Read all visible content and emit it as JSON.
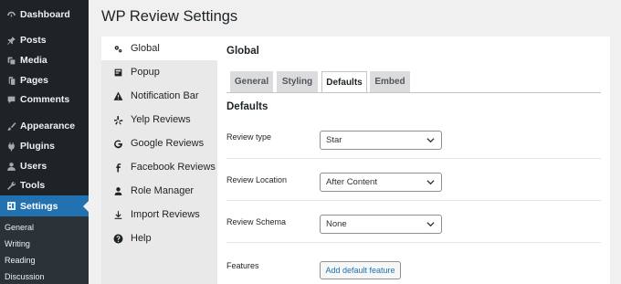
{
  "admin_menu": {
    "items": [
      {
        "label": "Dashboard",
        "icon": "dashboard-icon"
      },
      {
        "label": "Posts",
        "icon": "pin-icon"
      },
      {
        "label": "Media",
        "icon": "media-icon"
      },
      {
        "label": "Pages",
        "icon": "pages-icon"
      },
      {
        "label": "Comments",
        "icon": "comments-icon"
      },
      {
        "label": "Appearance",
        "icon": "brush-icon"
      },
      {
        "label": "Plugins",
        "icon": "plugin-icon"
      },
      {
        "label": "Users",
        "icon": "users-icon"
      },
      {
        "label": "Tools",
        "icon": "wrench-icon"
      },
      {
        "label": "Settings",
        "icon": "settings-icon"
      }
    ],
    "current": "Settings",
    "submenu": [
      "General",
      "Writing",
      "Reading",
      "Discussion"
    ]
  },
  "page": {
    "title": "WP Review Settings"
  },
  "settings_nav": {
    "items": [
      {
        "label": "Global",
        "icon": "gears-icon"
      },
      {
        "label": "Popup",
        "icon": "popup-icon"
      },
      {
        "label": "Notification Bar",
        "icon": "warning-icon"
      },
      {
        "label": "Yelp Reviews",
        "icon": "yelp-icon"
      },
      {
        "label": "Google Reviews",
        "icon": "google-icon"
      },
      {
        "label": "Facebook Reviews",
        "icon": "facebook-icon"
      },
      {
        "label": "Role Manager",
        "icon": "user-icon"
      },
      {
        "label": "Import Reviews",
        "icon": "download-icon"
      },
      {
        "label": "Help",
        "icon": "help-icon"
      }
    ],
    "active": "Global"
  },
  "panel": {
    "heading": "Global",
    "tabs": [
      {
        "label": "General"
      },
      {
        "label": "Styling"
      },
      {
        "label": "Defaults"
      },
      {
        "label": "Embed"
      }
    ],
    "active_tab": "Defaults",
    "section_heading": "Defaults",
    "fields": {
      "review_type": {
        "label": "Review type",
        "value": "Star"
      },
      "review_location": {
        "label": "Review Location",
        "value": "After Content"
      },
      "review_schema": {
        "label": "Review Schema",
        "value": "None"
      },
      "features": {
        "label": "Features",
        "button": "Add default feature"
      }
    }
  },
  "colors": {
    "admin_bar_bg": "#1d2327",
    "admin_accent": "#2271b1",
    "link": "#2271b1"
  }
}
